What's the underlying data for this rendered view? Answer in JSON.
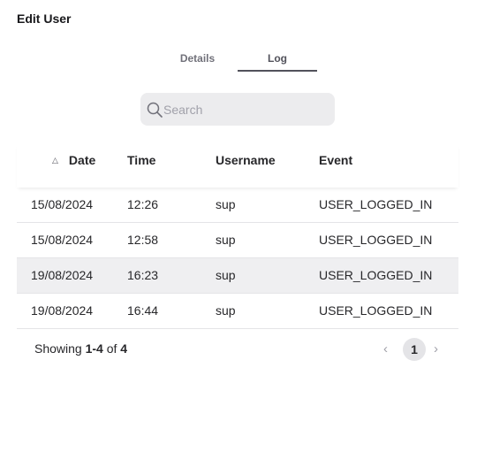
{
  "dialog": {
    "title": "Edit User"
  },
  "tabs": [
    {
      "label": "Details",
      "active": false
    },
    {
      "label": "Log",
      "active": true
    }
  ],
  "search": {
    "placeholder": "Search",
    "value": ""
  },
  "table": {
    "columns": [
      "Date",
      "Time",
      "Username",
      "Event"
    ],
    "sort": {
      "column": "Date",
      "direction": "ascending"
    },
    "rows": [
      {
        "date": "15/08/2024",
        "time": "12:26",
        "username": "sup",
        "event": "USER_LOGGED_IN"
      },
      {
        "date": "15/08/2024",
        "time": "12:58",
        "username": "sup",
        "event": "USER_LOGGED_IN"
      },
      {
        "date": "19/08/2024",
        "time": "16:23",
        "username": "sup",
        "event": "USER_LOGGED_IN"
      },
      {
        "date": "19/08/2024",
        "time": "16:44",
        "username": "sup",
        "event": "USER_LOGGED_IN"
      }
    ]
  },
  "footer": {
    "prefix": "Showing",
    "range": "1-4",
    "of_label": "of",
    "total": "4"
  },
  "pagination": {
    "current_page": "1"
  },
  "icons": {
    "search": "search-icon",
    "sort": "sort-ascending-icon",
    "prev": "chevron-left-icon",
    "next": "chevron-right-icon"
  },
  "colors": {
    "tab_active": "#52525b",
    "search_bg": "#ececee",
    "row_highlight": "#efeff1"
  }
}
